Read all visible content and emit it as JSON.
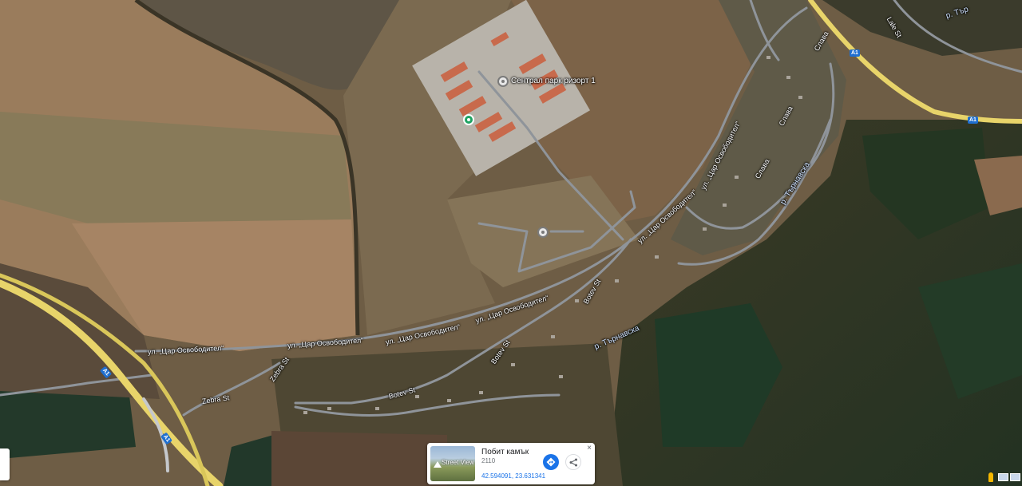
{
  "map": {
    "type": "satellite",
    "poi": {
      "label": "Сентрал парк ризорт 1"
    },
    "road_labels": {
      "tsar_1": "ул. „Цар Освободител“",
      "tsar_2": "ул. „Цар Освободител“",
      "tsar_3": "ул. „Цар Освободител“",
      "tsar_4": "ул. „Цар Освободител“",
      "tsar_5": "ул. „Цар Освободител“",
      "tsar_6": "ул. „Цар Освободител“",
      "botev_1": "Botev St",
      "botev_2": "Botev St",
      "botev_3": "Botev St",
      "zebra_1": "Zebra St",
      "zebra_2": "Zebra St",
      "slava_1": "Слава",
      "slava_2": "Слава",
      "slava_3": "Слава",
      "lale": "Lale St",
      "river_1": "р. Търнавска",
      "river_2": "р. Търнавска",
      "river_top": "р. Тър"
    },
    "highway_shield": "A1"
  },
  "info_card": {
    "title": "Побит камък",
    "postcode": "2110",
    "coordinates": "42.594091, 23.631341",
    "street_view_label": "Street View",
    "close_symbol": "×"
  },
  "colors": {
    "highway": "#e8d46a",
    "road": "#8f949a",
    "accent": "#1a73e8",
    "poi_green": "#1ea362"
  }
}
